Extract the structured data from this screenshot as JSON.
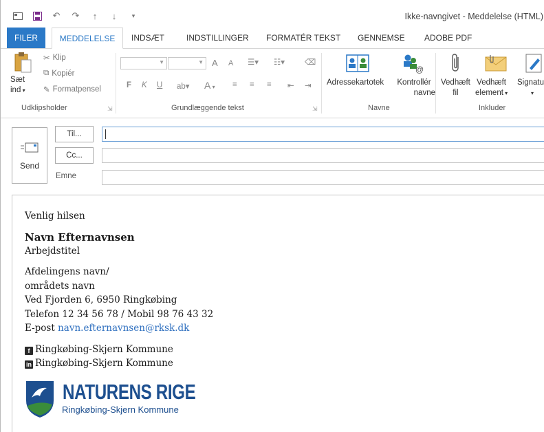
{
  "window": {
    "title": "Ikke-navngivet - Meddelelse (HTML)",
    "qat": [
      "envelope-icon",
      "save-icon",
      "undo-icon",
      "redo-icon",
      "up-arrow-icon",
      "down-arrow-icon",
      "customize-icon"
    ]
  },
  "tabs": [
    {
      "label": "FILER"
    },
    {
      "label": "MEDDELELSE"
    },
    {
      "label": "INDSÆT"
    },
    {
      "label": "INDSTILLINGER"
    },
    {
      "label": "FORMATÉR TEKST"
    },
    {
      "label": "GENNEMSE"
    },
    {
      "label": "ADOBE PDF"
    }
  ],
  "ribbon": {
    "clipboard": {
      "paste_line1": "Sæt",
      "paste_line2": "ind",
      "cut": "Klip",
      "copy": "Kopiér",
      "format_painter": "Formatpensel",
      "group": "Udklipsholder"
    },
    "basic_text": {
      "bold": "F",
      "italic": "K",
      "underline": "U",
      "grow": "A",
      "shrink": "A",
      "font_color": "A",
      "group": "Grundlæggende tekst"
    },
    "names": {
      "address_book": "Adressekartotek",
      "check_names_line1": "Kontrollér",
      "check_names_line2": "navne",
      "group": "Navne"
    },
    "include": {
      "attach_file_line1": "Vedhæft",
      "attach_file_line2": "fil",
      "attach_item_line1": "Vedhæft",
      "attach_item_line2": "element",
      "signature": "Signatu",
      "group": "Inkluder"
    }
  },
  "compose": {
    "send": "Send",
    "to_btn": "Til...",
    "cc_btn": "Cc...",
    "subject_label": "Emne",
    "to_value": "",
    "cc_value": "",
    "subject_value": ""
  },
  "signature": {
    "greeting": "Venlig hilsen",
    "name": "Navn Efternavnsen",
    "job_title": "Arbejdstitel",
    "dept_line1": "Afdelingens navn/",
    "dept_line2": "områdets navn",
    "address": "Ved Fjorden 6, 6950 Ringkøbing",
    "phone": "Telefon 12 34 56 78 / Mobil 98 76 43 32",
    "email_label": "E-post",
    "email": "navn.efternavnsen@rksk.dk",
    "facebook": "Ringkøbing-Skjern Kommune",
    "linkedin": "Ringkøbing-Skjern Kommune",
    "logo_title": "NATURENS RIGE",
    "logo_subtitle": "Ringkøbing-Skjern Kommune"
  },
  "colors": {
    "accent": "#2b79c7",
    "logo_blue": "#1d4f8f",
    "logo_green": "#3a8c3a",
    "link": "#2e6fbf"
  }
}
